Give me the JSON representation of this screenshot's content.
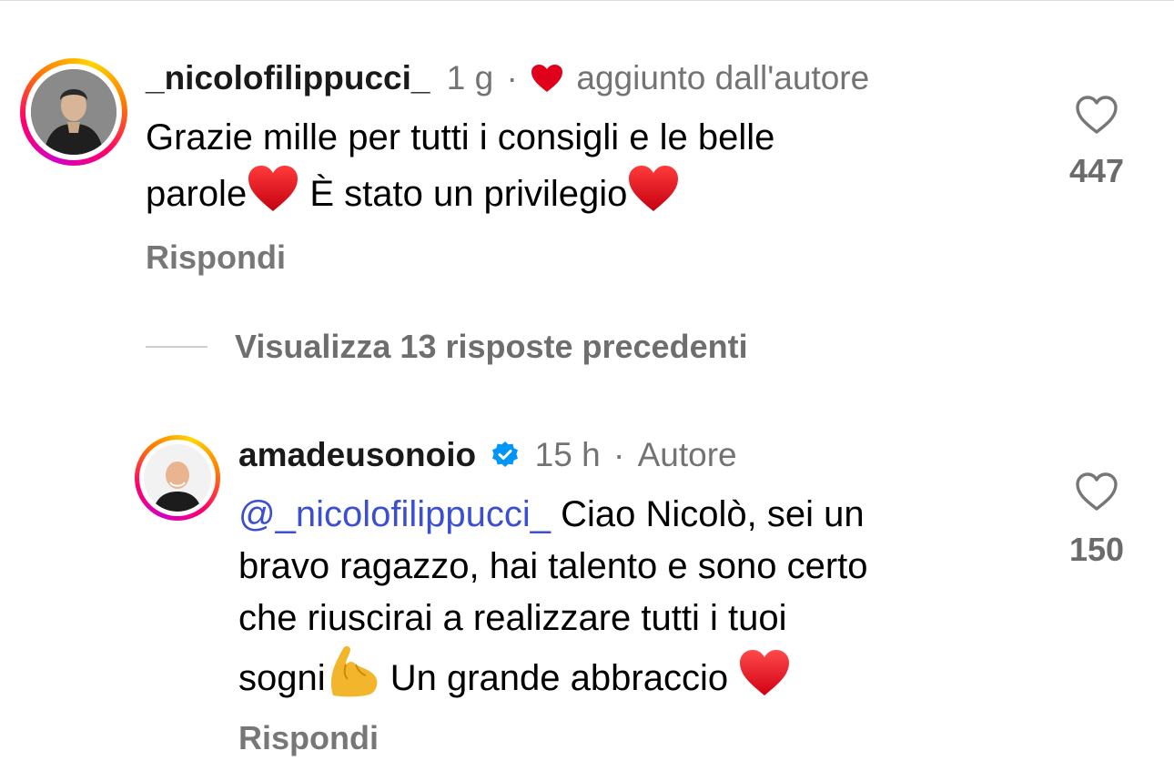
{
  "comments": [
    {
      "username": "_nicolofilippucci_",
      "time": "1 g",
      "separator": "·",
      "author_liked_label": "aggiunto dall'autore",
      "text_line1": "Grazie mille per tutti i consigli e le belle",
      "text_line2_a": "parole",
      "text_line2_b": " È stato un privilegio",
      "likes": "447",
      "reply_label": "Rispondi",
      "avatar_icon": "profile-photo-young-man"
    },
    {
      "username": "amadeusonoio",
      "verified_icon": "verified-badge-icon",
      "time": "15 h",
      "separator": "·",
      "author_label": "Autore",
      "mention": "@_nicolofilippucci_",
      "text_line1_rest": " Ciao Nicolò, sei un",
      "text_line2": "bravo ragazzo, hai talento e sono certo",
      "text_line3": "che riuscirai a realizzare tutti i tuoi",
      "text_line4_a": "sogni",
      "text_line4_b": " Un grande abbraccio ",
      "likes": "150",
      "reply_label": "Rispondi",
      "avatar_icon": "profile-photo-bald-man"
    }
  ],
  "view_replies": {
    "label": "Visualizza 13 risposte precedenti"
  },
  "colors": {
    "mention": "#3b4fd0",
    "heart": "#e0001b",
    "verified": "#0095f6",
    "meta": "#737373"
  }
}
